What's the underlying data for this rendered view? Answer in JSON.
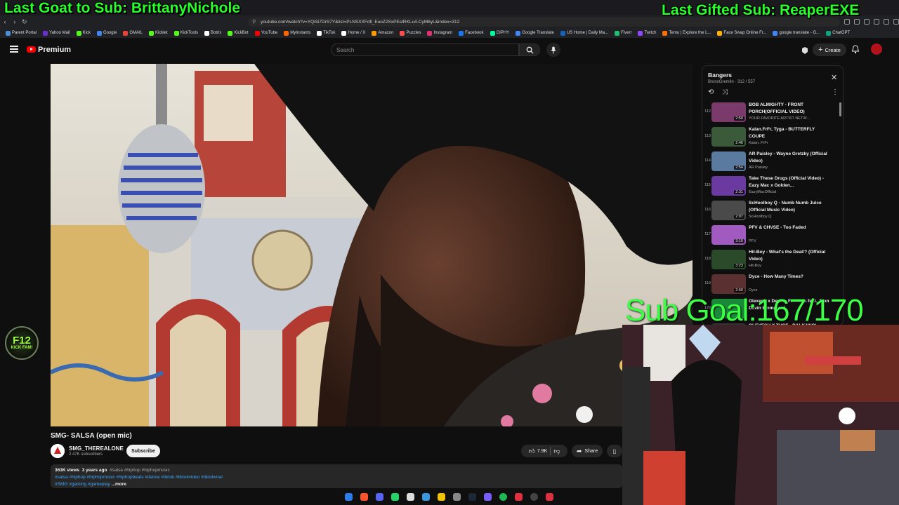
{
  "overlays": {
    "last_goat": "Last Goat to Sub: BrittanyNichole",
    "last_gifted": "Last Gifted Sub: ReaperEXE",
    "sub_goal": "Sub Goal:167/170"
  },
  "browser": {
    "url": "youtube.com/watch?v=YQiSi7DrS7Y&list=PLNSXXFdIl_EuoZ2SxPEsIRKLu4-CyM6yL&index=312",
    "bookmarks": [
      "Parent Portal",
      "Yahoo Mail",
      "Kick",
      "Google",
      "GMAIL",
      "Kicklet",
      "KickTools",
      "Botrix",
      "KickBot",
      "YouTube",
      "MyInstants",
      "TikTok",
      "Home / X",
      "Amazon",
      "Puzzles",
      "Instagram",
      "Facebook",
      "GIPHY",
      "Google Translate",
      "US Home | Daily Ma...",
      "Fiverr",
      "Twitch",
      "Temu | Explore the L...",
      "Face Swap Online Fr...",
      "google translate - G...",
      "ChatGPT"
    ],
    "bookmark_colors": [
      "#4a90d9",
      "#6b2fd1",
      "#53fc18",
      "#4285f4",
      "#ea4335",
      "#53fc18",
      "#53fc18",
      "#ffffff",
      "#53fc18",
      "#ff0000",
      "#ff6600",
      "#ffffff",
      "#ffffff",
      "#ff9900",
      "#ff4d4d",
      "#e1306c",
      "#1877f2",
      "#00ff99",
      "#4285f4",
      "#1565c0",
      "#1dbf73",
      "#9146ff",
      "#ff6f00",
      "#ffb300",
      "#4285f4",
      "#10a37f"
    ]
  },
  "youtube": {
    "logo_text": "Premium",
    "search_placeholder": "Search",
    "create_label": "Create"
  },
  "video": {
    "title": "SMG- SALSA (open mic)",
    "channel": "SMG_THEREALONE",
    "subscribers": "2.47K subscribers",
    "subscribe_label": "Subscribe",
    "likes": "7.9K",
    "share_label": "Share",
    "views": "363K views",
    "age": "3 years ago",
    "hashtags_line1": "#salsa #hiphop #hiphopmusic",
    "hashtags_line2": "#salsa #hiphop #hiphopmusic #hiphopbeats #dance #tiktok #tiktokvideo #tiktokviral",
    "hashtags_line3": "#SMG #gaming #gameplay",
    "more_label": "...more"
  },
  "playlist": {
    "title": "Bangers",
    "owner": "BronxGremlin",
    "position": "312 / 557",
    "items": [
      {
        "num": "112",
        "title": "BOB ALMIGHTY - FRONT PORCH(OFFICIAL VIDEO)",
        "channel": "YOUR FAVORITE ARTIST NETW...",
        "duration": "2:50",
        "color": "#7a3a6a"
      },
      {
        "num": "113",
        "title": "Kalan.FrFr, Tyga - BUTTERFLY COUPE",
        "channel": "Kalan. FrFr",
        "duration": "2:46",
        "color": "#3a5a3a"
      },
      {
        "num": "114",
        "title": "AR Paisley - Wayne Gretzky (Official Video)",
        "channel": "AR Paisley",
        "duration": "2:54",
        "color": "#5a7aa0"
      },
      {
        "num": "115",
        "title": "Take These Drugs (Official Video) - Eazy Mac x Golden...",
        "channel": "EazyMacOfficial",
        "duration": "2:31",
        "color": "#6a3aa0"
      },
      {
        "num": "116",
        "title": "ScHoolboy Q - Numb Numb Juice (Official Music Video)",
        "channel": "ScHoolboy Q",
        "duration": "2:07",
        "color": "#4a4a4a"
      },
      {
        "num": "117",
        "title": "PFV & CHVSE - Too Faded",
        "channel": "PFV",
        "duration": "3:10",
        "color": "#a05ac0"
      },
      {
        "num": "118",
        "title": "Hit-Boy - What's the Deal!? (Official Video)",
        "channel": "Hit-Boy",
        "duration": "3:23",
        "color": "#2a4a2a"
      },
      {
        "num": "119",
        "title": "Dyce - How Many Times?",
        "channel": "Dyce",
        "duration": "2:50",
        "color": "#5a3030"
      },
      {
        "num": "120",
        "title": "Olexesh x Devin - Fantasia feat. Juan Devin Emmanuel",
        "channel": "",
        "duration": "",
        "color": "#1a8a3a"
      },
      {
        "num": "",
        "title": "OLEXESH X THCF - BALKANCI",
        "channel": "",
        "duration": "",
        "color": "#333333"
      }
    ]
  },
  "kick_badge": {
    "line1": "F12",
    "line2": "KICK FAM!"
  }
}
